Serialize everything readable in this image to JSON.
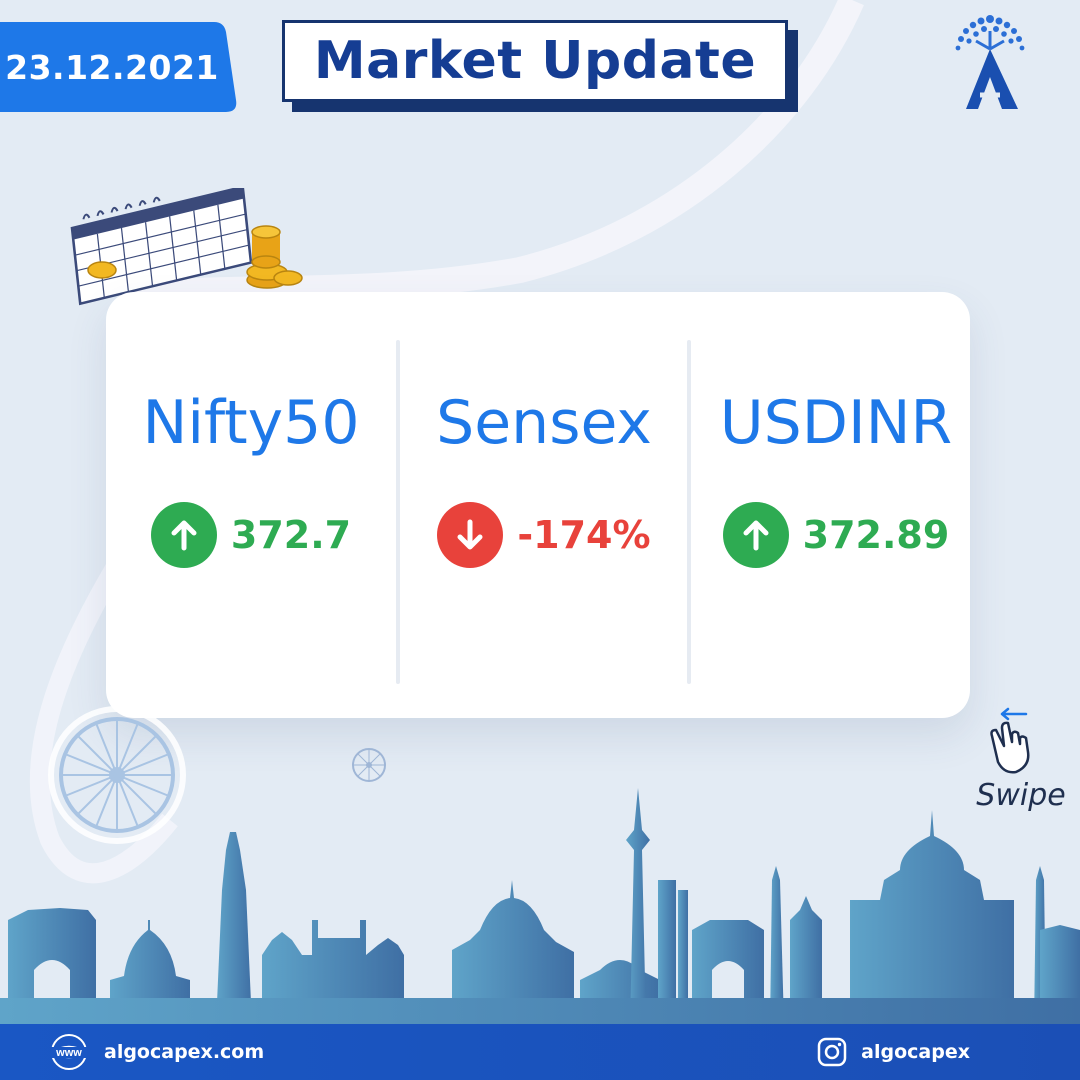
{
  "header": {
    "date": "23.12.2021",
    "title": "Market Update"
  },
  "markets": [
    {
      "name": "Nifty50",
      "direction": "up",
      "value": "372.7",
      "color": "#2eab52"
    },
    {
      "name": "Sensex",
      "direction": "down",
      "value": "-174%",
      "color": "#e8423b"
    },
    {
      "name": "USDINR",
      "direction": "up",
      "value": "372.89",
      "color": "#2eab52"
    }
  ],
  "swipe": {
    "label": "Swipe",
    "icon": "swipe-hand-icon"
  },
  "footer": {
    "website_icon": "www",
    "website": "algocapex.com",
    "instagram_icon": "instagram-icon",
    "instagram": "algocapex"
  },
  "colors": {
    "background": "#e3ebf4",
    "brand_blue": "#1e78e8",
    "navy": "#16346f",
    "positive": "#2eab52",
    "negative": "#e8423b",
    "footer": "#1a57c4"
  }
}
